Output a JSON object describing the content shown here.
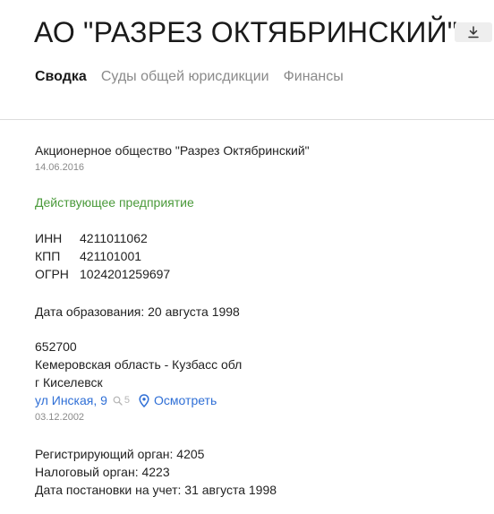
{
  "header": {
    "title": "АО \"РАЗРЕЗ ОКТЯБРИНСКИЙ\"",
    "download_icon": "download-icon"
  },
  "tabs": [
    {
      "label": "Сводка",
      "active": true
    },
    {
      "label": "Суды общей юрисдикции",
      "active": false
    },
    {
      "label": "Финансы",
      "active": false
    }
  ],
  "company": {
    "full_name": "Акционерное общество \"Разрез Октябринский\"",
    "name_date": "14.06.2016",
    "status": "Действующее предприятие",
    "codes": [
      {
        "key": "ИНН",
        "value": "4211011062"
      },
      {
        "key": "КПП",
        "value": "421101001"
      },
      {
        "key": "ОГРН",
        "value": "1024201259697"
      }
    ],
    "founded": "Дата образования: 20 августа 1998"
  },
  "address": {
    "postcode": "652700",
    "region": "Кемеровская область - Кузбасс обл",
    "city": "г Киселевск",
    "street": "ул Инская, 9",
    "street_count": "5",
    "view_label": "Осмотреть",
    "date": "03.12.2002"
  },
  "registration": {
    "reg_authority": "Регистрирующий орган: 4205",
    "tax_authority": "Налоговый орган: 4223",
    "registered_date": "Дата постановки на учет: 31 августа 1998"
  },
  "colors": {
    "status_green": "#4a9a3a",
    "link_blue": "#2f6fd6",
    "muted_gray": "#8a8a8a"
  }
}
